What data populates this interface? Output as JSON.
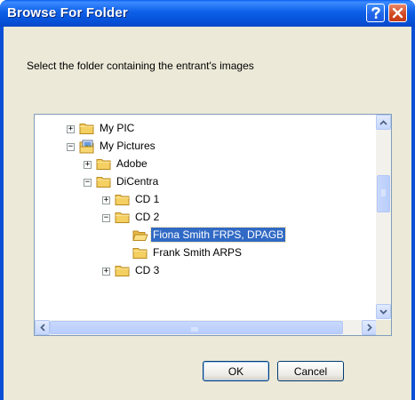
{
  "window": {
    "title": "Browse For Folder"
  },
  "dialog": {
    "instruction": "Select the folder containing the entrant's images"
  },
  "tree": {
    "items": [
      {
        "label": "My PIC",
        "level": 1,
        "expander": "+",
        "icon": "folder-icon",
        "selected": false
      },
      {
        "label": "My Pictures",
        "level": 1,
        "expander": "-",
        "icon": "pictures-folder-icon",
        "selected": false
      },
      {
        "label": "Adobe",
        "level": 2,
        "expander": "+",
        "icon": "folder-icon",
        "selected": false
      },
      {
        "label": "DiCentra",
        "level": 2,
        "expander": "-",
        "icon": "folder-icon",
        "selected": false
      },
      {
        "label": "CD 1",
        "level": 3,
        "expander": "+",
        "icon": "folder-icon",
        "selected": false
      },
      {
        "label": "CD 2",
        "level": 3,
        "expander": "-",
        "icon": "folder-icon",
        "selected": false
      },
      {
        "label": "Fiona Smith FRPS, DPAGB",
        "level": 4,
        "expander": "",
        "icon": "folder-open-icon",
        "selected": true
      },
      {
        "label": "Frank Smith ARPS",
        "level": 4,
        "expander": "",
        "icon": "folder-icon",
        "selected": false
      },
      {
        "label": "CD 3",
        "level": 3,
        "expander": "+",
        "icon": "folder-icon",
        "selected": false
      }
    ]
  },
  "buttons": {
    "ok_label": "OK",
    "cancel_label": "Cancel"
  },
  "colors": {
    "title_bar": "#0a5ff0",
    "selection": "#316ac5",
    "dialog_bg": "#ece9d8",
    "close_button": "#d0471f"
  }
}
